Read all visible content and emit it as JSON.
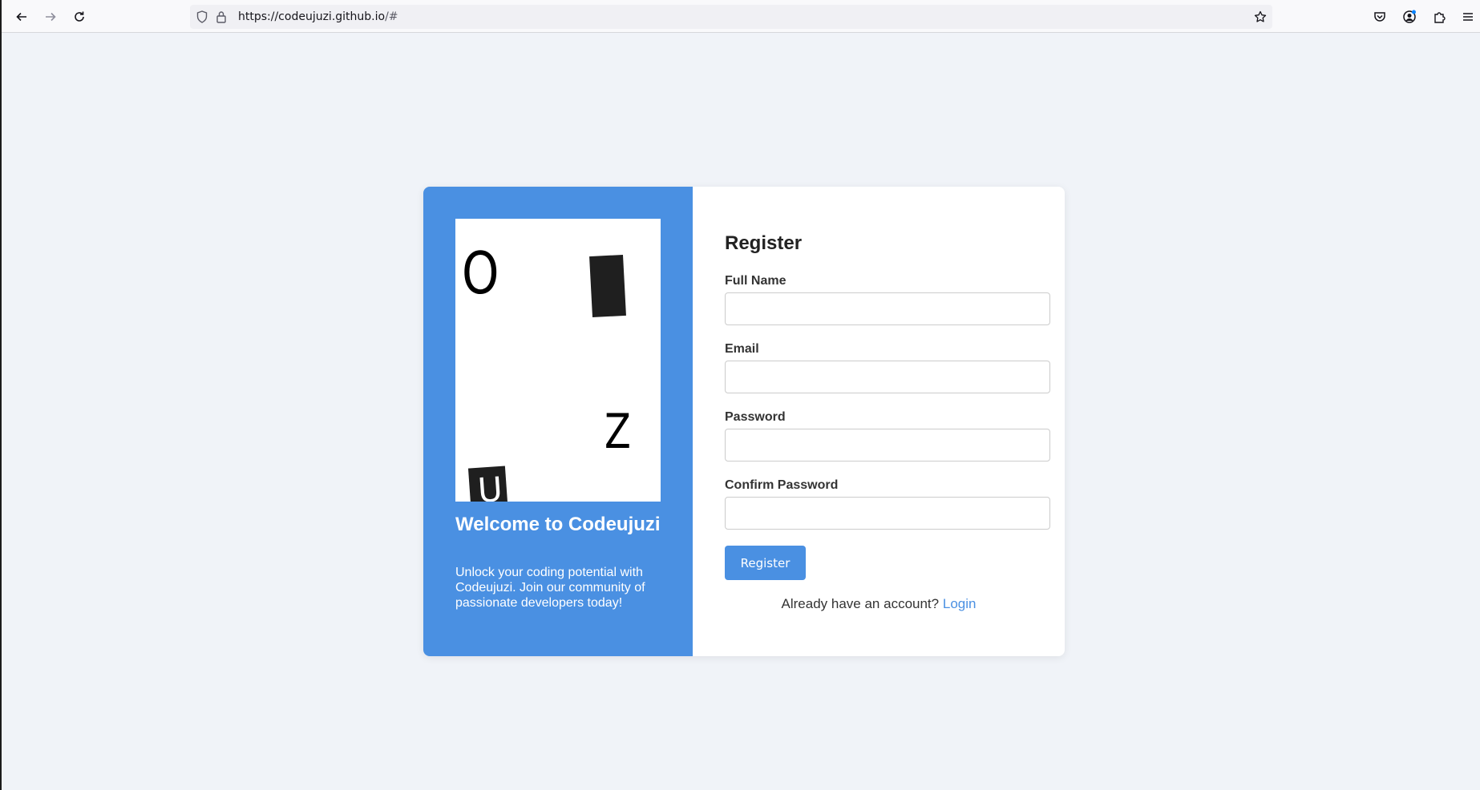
{
  "browser": {
    "url_host": "https://codeujuzi.github.io",
    "url_path": "/#",
    "icons": {
      "back": "arrow-left-icon",
      "forward": "arrow-right-icon",
      "reload": "reload-icon",
      "shield": "shield-icon",
      "lock": "lock-icon",
      "bookmark": "star-icon",
      "pocket": "pocket-icon",
      "account": "account-icon",
      "extensions": "puzzle-icon",
      "menu": "hamburger-menu-icon"
    }
  },
  "welcome": {
    "captcha_chars": [
      "O",
      "Z",
      "U"
    ],
    "title": "Welcome to Codeujuzi",
    "text": "Unlock your coding potential with Codeujuzi. Join our community of passionate developers today!"
  },
  "form": {
    "title": "Register",
    "fields": [
      {
        "label": "Full Name",
        "value": ""
      },
      {
        "label": "Email",
        "value": ""
      },
      {
        "label": "Password",
        "value": ""
      },
      {
        "label": "Confirm Password",
        "value": ""
      }
    ],
    "submit_label": "Register",
    "login_prompt": "Already have an account?",
    "login_link": "Login"
  },
  "colors": {
    "accent": "#4a90e2",
    "page_bg": "#f0f3f8"
  }
}
